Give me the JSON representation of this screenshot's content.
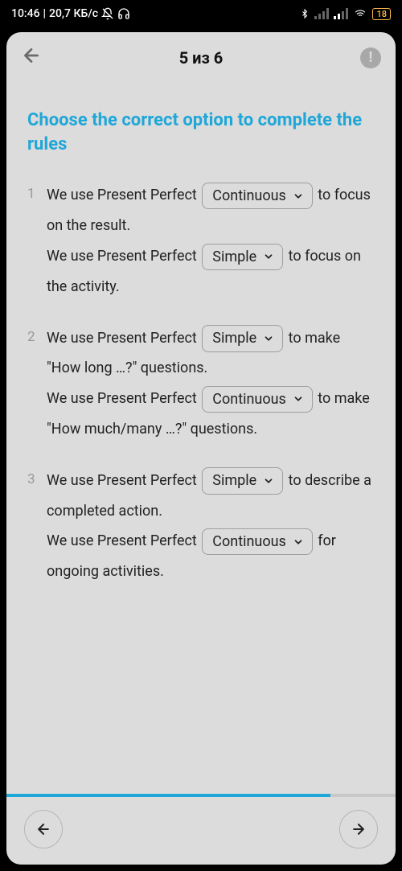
{
  "status": {
    "time": "10:46",
    "net": "20,7 КБ/с",
    "battery": "18"
  },
  "header": {
    "title": "5 из 6"
  },
  "instruction": "Choose the correct option to complete the rules",
  "questions": [
    {
      "num": "1",
      "t1a": "We use Present Perfect ",
      "d1": "Continuous",
      "t1b": " to focus on the result.",
      "t2a": "We use Present Perfect ",
      "d2": "Simple",
      "t2b": " to focus on the activity."
    },
    {
      "num": "2",
      "t1a": "We use Present Perfect ",
      "d1": "Simple",
      "t1b": " to make \"How long …?\" questions.",
      "t2a": "We use Present Perfect ",
      "d2": "Continuous",
      "t2b": " to make \"How much/many …?\" questions."
    },
    {
      "num": "3",
      "t1a": "We use Present Perfect ",
      "d1": "Simple",
      "t1b": " to describe a completed action.",
      "t2a": "We use Present Perfect ",
      "d2": "Continuous",
      "t2b": " for ongoing activities."
    }
  ]
}
